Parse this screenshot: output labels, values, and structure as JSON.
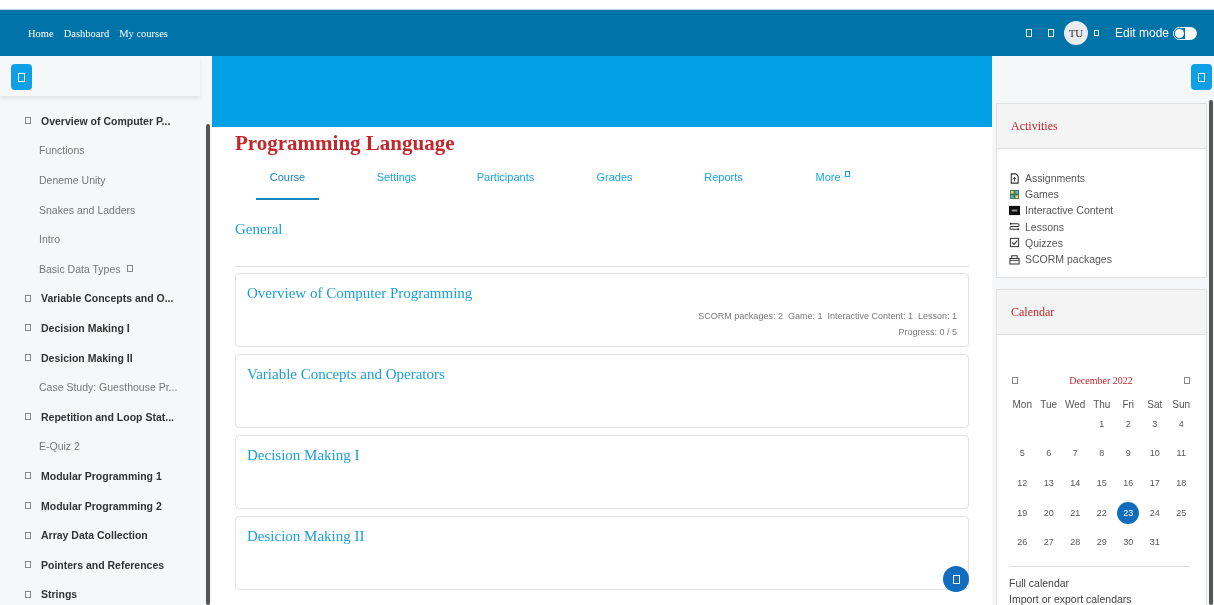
{
  "navbar": {
    "links": [
      "Home",
      "Dashboard",
      "My courses"
    ],
    "avatar": "TU",
    "edit_mode_label": "Edit mode",
    "edit_mode": false
  },
  "sidebar": {
    "items": [
      {
        "label": "Overview of Computer P...",
        "kind": "section"
      },
      {
        "label": "Functions",
        "kind": "activity"
      },
      {
        "label": "Deneme Unity",
        "kind": "activity"
      },
      {
        "label": "Snakes and Ladders",
        "kind": "activity"
      },
      {
        "label": "Intro",
        "kind": "activity"
      },
      {
        "label": "Basic Data Types",
        "kind": "activity-flagged"
      },
      {
        "label": "Variable Concepts and O...",
        "kind": "section"
      },
      {
        "label": "Decision Making I",
        "kind": "section"
      },
      {
        "label": "Desicion Making II",
        "kind": "section"
      },
      {
        "label": "Case Study: Guesthouse Pr...",
        "kind": "activity"
      },
      {
        "label": "Repetition and Loop Stat...",
        "kind": "section"
      },
      {
        "label": "E-Quiz 2",
        "kind": "activity"
      },
      {
        "label": "Modular Programming 1",
        "kind": "section"
      },
      {
        "label": "Modular Programming 2",
        "kind": "section"
      },
      {
        "label": "Array Data Collection",
        "kind": "section"
      },
      {
        "label": "Pointers and References",
        "kind": "section"
      },
      {
        "label": "Strings",
        "kind": "section"
      }
    ]
  },
  "course": {
    "title": "Programming Language",
    "tabs": [
      {
        "label": "Course",
        "selected": true,
        "dropdown": false
      },
      {
        "label": "Settings",
        "selected": false,
        "dropdown": false
      },
      {
        "label": "Participants",
        "selected": false,
        "dropdown": false
      },
      {
        "label": "Grades",
        "selected": false,
        "dropdown": false
      },
      {
        "label": "Reports",
        "selected": false,
        "dropdown": false
      },
      {
        "label": "More",
        "selected": false,
        "dropdown": true
      }
    ],
    "general": "General",
    "sections": [
      {
        "title": "Overview of Computer Programming",
        "stats": "SCORM packages: 2  Game: 1  Interactive Content: 1  Lesson: 1",
        "progress": "Progress: 0 / 5"
      },
      {
        "title": "Variable Concepts and Operators"
      },
      {
        "title": "Decision Making I"
      },
      {
        "title": "Desicion Making II"
      }
    ]
  },
  "activities": {
    "title": "Activities",
    "items": [
      {
        "label": "Assignments",
        "kind": "assignment"
      },
      {
        "label": "Games",
        "kind": "game"
      },
      {
        "label": "Interactive Content",
        "kind": "h5p"
      },
      {
        "label": "Lessons",
        "kind": "lesson"
      },
      {
        "label": "Quizzes",
        "kind": "quiz"
      },
      {
        "label": "SCORM packages",
        "kind": "scorm"
      }
    ]
  },
  "calendar": {
    "title": "Calendar",
    "month": "December 2022",
    "weekdays": [
      "Mon",
      "Tue",
      "Wed",
      "Thu",
      "Fri",
      "Sat",
      "Sun"
    ],
    "weeks": [
      [
        {
          "kind": "blank"
        },
        {
          "kind": "blank"
        },
        {
          "kind": "blank"
        },
        {
          "day": "1",
          "selected": false
        },
        {
          "day": "2",
          "selected": false
        },
        {
          "day": "3",
          "selected": false
        },
        {
          "day": "4",
          "selected": false
        }
      ],
      [
        {
          "day": "5",
          "selected": false
        },
        {
          "day": "6",
          "selected": false
        },
        {
          "day": "7",
          "selected": false
        },
        {
          "day": "8",
          "selected": false
        },
        {
          "day": "9",
          "selected": false
        },
        {
          "day": "10",
          "selected": false
        },
        {
          "day": "11",
          "selected": false
        }
      ],
      [
        {
          "day": "12",
          "selected": false
        },
        {
          "day": "13",
          "selected": false
        },
        {
          "day": "14",
          "selected": false
        },
        {
          "day": "15",
          "selected": false
        },
        {
          "day": "16",
          "selected": false
        },
        {
          "day": "17",
          "selected": false
        },
        {
          "day": "18",
          "selected": false
        }
      ],
      [
        {
          "day": "19",
          "selected": false
        },
        {
          "day": "20",
          "selected": false
        },
        {
          "day": "21",
          "selected": false
        },
        {
          "day": "22",
          "selected": false
        },
        {
          "day": "23",
          "selected": true
        },
        {
          "day": "24",
          "selected": false
        },
        {
          "day": "25",
          "selected": false
        }
      ],
      [
        {
          "day": "26",
          "selected": false
        },
        {
          "day": "27",
          "selected": false
        },
        {
          "day": "28",
          "selected": false
        },
        {
          "day": "29",
          "selected": false
        },
        {
          "day": "30",
          "selected": false
        },
        {
          "day": "31",
          "selected": false
        },
        {
          "kind": "blank"
        }
      ]
    ],
    "links": [
      "Full calendar",
      "Import or export calendars"
    ]
  }
}
